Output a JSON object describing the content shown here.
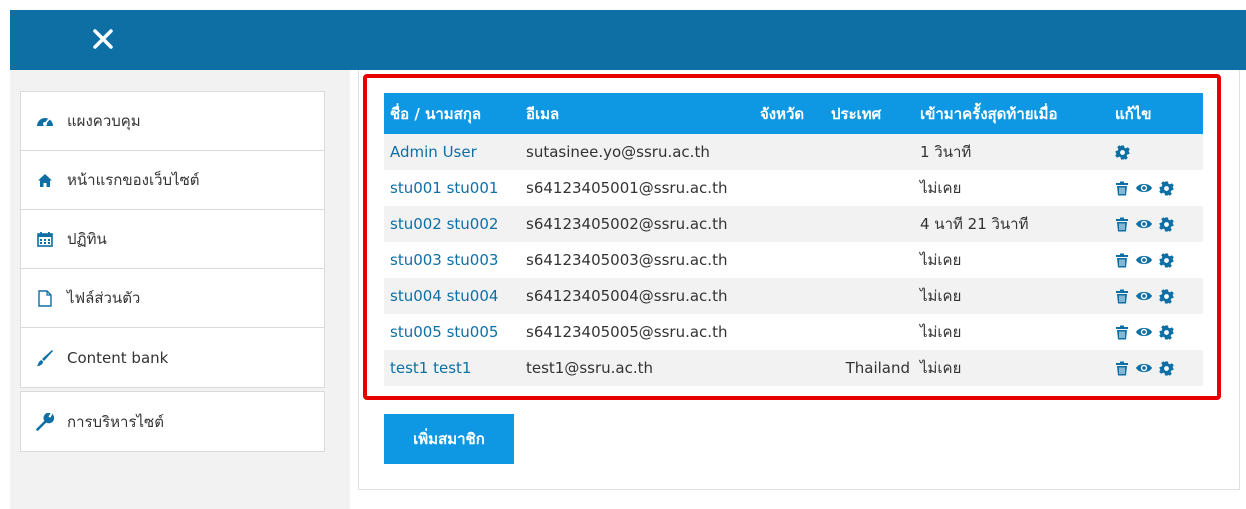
{
  "topbar": {
    "close_icon": "close-icon",
    "color": "#0e6fa4"
  },
  "nav": {
    "items": [
      {
        "label": "แผงควบคุม",
        "icon": "dashboard-icon"
      },
      {
        "label": "หน้าแรกของเว็บไซต์",
        "icon": "home-icon"
      },
      {
        "label": "ปฏิทิน",
        "icon": "calendar-icon"
      },
      {
        "label": "ไฟล์ส่วนตัว",
        "icon": "file-icon"
      },
      {
        "label": "Content bank",
        "icon": "paintbrush-icon"
      }
    ],
    "admin": {
      "label": "การบริหารไซต์",
      "icon": "wrench-icon"
    }
  },
  "table": {
    "headers": {
      "name": "ชื่อ / นามสกุล",
      "email": "อีเมล",
      "province": "จังหวัด",
      "country": "ประเทศ",
      "lastaccess": "เข้ามาครั้งสุดท้ายเมื่อ",
      "edit": "แก้ไข"
    },
    "rows": [
      {
        "name": "Admin User",
        "email": "sutasinee.yo@ssru.ac.th",
        "province": "",
        "country": "",
        "lastaccess": "1 วินาที",
        "actions": [
          "gear-icon"
        ]
      },
      {
        "name": "stu001 stu001",
        "email": "s64123405001@ssru.ac.th",
        "province": "",
        "country": "",
        "lastaccess": "ไม่เคย",
        "actions": [
          "trash-icon",
          "eye-icon",
          "gear-icon"
        ]
      },
      {
        "name": "stu002 stu002",
        "email": "s64123405002@ssru.ac.th",
        "province": "",
        "country": "",
        "lastaccess": "4 นาที 21 วินาที",
        "actions": [
          "trash-icon",
          "eye-icon",
          "gear-icon"
        ]
      },
      {
        "name": "stu003 stu003",
        "email": "s64123405003@ssru.ac.th",
        "province": "",
        "country": "",
        "lastaccess": "ไม่เคย",
        "actions": [
          "trash-icon",
          "eye-icon",
          "gear-icon"
        ]
      },
      {
        "name": "stu004 stu004",
        "email": "s64123405004@ssru.ac.th",
        "province": "",
        "country": "",
        "lastaccess": "ไม่เคย",
        "actions": [
          "trash-icon",
          "eye-icon",
          "gear-icon"
        ]
      },
      {
        "name": "stu005 stu005",
        "email": "s64123405005@ssru.ac.th",
        "province": "",
        "country": "",
        "lastaccess": "ไม่เคย",
        "actions": [
          "trash-icon",
          "eye-icon",
          "gear-icon"
        ]
      },
      {
        "name": "test1 test1",
        "email": "test1@ssru.ac.th",
        "province": "",
        "country": "Thailand",
        "lastaccess": "ไม่เคย",
        "actions": [
          "trash-icon",
          "eye-icon",
          "gear-icon"
        ]
      }
    ]
  },
  "add_button": {
    "label": "เพิ่มสมาชิก"
  },
  "colors": {
    "accent": "#0e98e4",
    "link": "#0e6fa4",
    "highlight": "#e60000"
  }
}
